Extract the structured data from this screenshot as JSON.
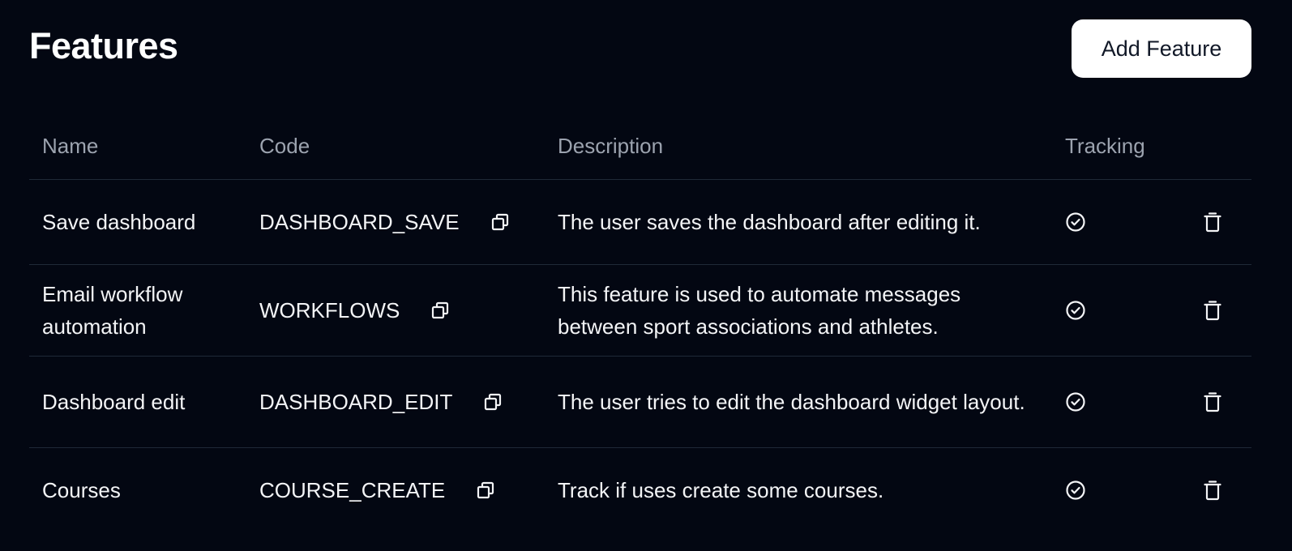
{
  "header": {
    "title": "Features",
    "add_button_label": "Add Feature"
  },
  "table": {
    "columns": {
      "name": "Name",
      "code": "Code",
      "description": "Description",
      "tracking": "Tracking"
    },
    "rows": [
      {
        "name": "Save dashboard",
        "code": "DASHBOARD_SAVE",
        "description": "The user saves the dashboard after editing it.",
        "tracking": true
      },
      {
        "name": "Email workflow automation",
        "code": "WORKFLOWS",
        "description": "This feature is used to automate messages between sport associations and athletes.",
        "tracking": true
      },
      {
        "name": "Dashboard edit",
        "code": "DASHBOARD_EDIT",
        "description": "The user tries to edit the dashboard widget layout.",
        "tracking": true
      },
      {
        "name": "Courses",
        "code": "COURSE_CREATE",
        "description": "Track if uses create some courses.",
        "tracking": true
      }
    ]
  },
  "icons": {
    "copy": "copy-icon",
    "tracking": "check-circle-icon",
    "delete": "trash-icon"
  },
  "colors": {
    "background": "#030712",
    "button_background": "#ffffff",
    "header_text": "#9ca3af",
    "divider": "#1f2937"
  }
}
